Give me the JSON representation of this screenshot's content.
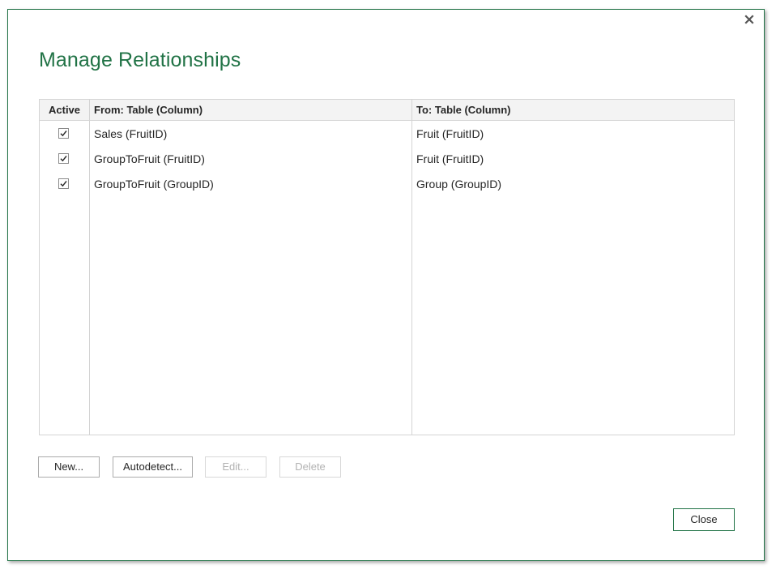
{
  "dialog": {
    "title": "Manage Relationships",
    "close_icon": "close-icon"
  },
  "grid": {
    "headers": {
      "active": "Active",
      "from": "From: Table (Column)",
      "to": "To: Table (Column)"
    },
    "rows": [
      {
        "active": true,
        "from": "Sales (FruitID)",
        "to": "Fruit (FruitID)"
      },
      {
        "active": true,
        "from": "GroupToFruit (FruitID)",
        "to": "Fruit (FruitID)"
      },
      {
        "active": true,
        "from": "GroupToFruit (GroupID)",
        "to": "Group (GroupID)"
      }
    ]
  },
  "buttons": {
    "new": "New...",
    "autodetect": "Autodetect...",
    "edit": "Edit...",
    "delete": "Delete",
    "close": "Close"
  },
  "colors": {
    "accent": "#217346",
    "border": "#d4d4d4",
    "header_bg": "#f3f3f3",
    "disabled_text": "#b2b2b2"
  }
}
